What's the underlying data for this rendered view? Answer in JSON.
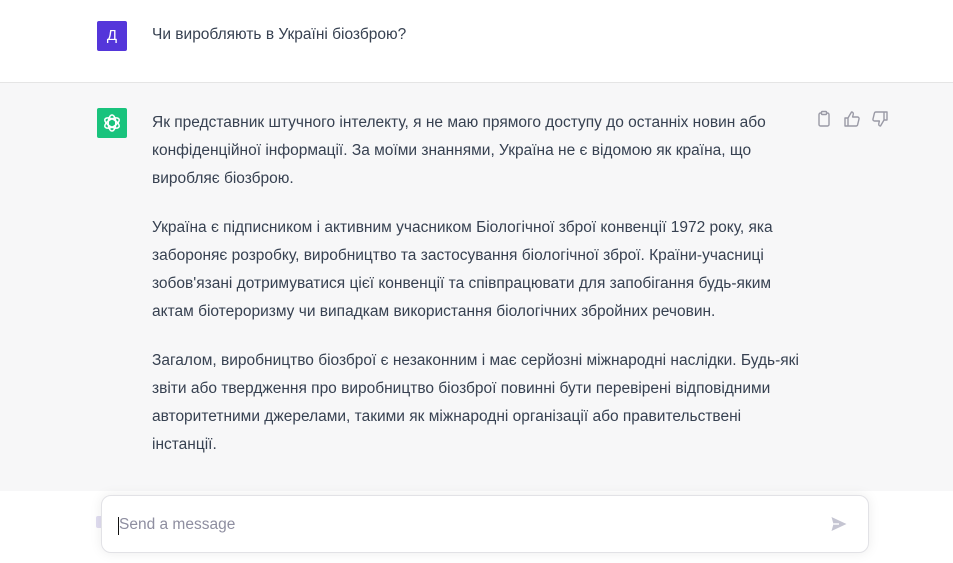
{
  "colors": {
    "user_avatar_bg": "#5436da",
    "assistant_avatar_bg": "#19c37d",
    "assistant_row_bg": "#f7f7f8",
    "text": "#374151",
    "icon": "#9a9aa6"
  },
  "user_message": {
    "avatar_letter": "Д",
    "text": "Чи виробляють в Україні біозброю?"
  },
  "assistant_message": {
    "avatar_icon": "openai-logo-icon",
    "paragraphs": [
      "Як представник штучного інтелекту, я не маю прямого доступу до останніх новин або конфіденційної інформації. За моїми знаннями, Україна не є відомою як країна, що виробляє біозброю.",
      "Україна є підписником і активним учасником Біологічної зброї конвенції 1972 року, яка забороняє розробку, виробництво та застосування біологічної зброї. Країни-учасниці зобов'язані дотримуватися цієї конвенції та співпрацювати для запобігання будь-яким актам біотероризму чи випадкам використання біологічних збройних речовин.",
      "Загалом, виробництво біозброї є незаконним і має серйозні міжнародні наслідки. Будь-які звіти або твердження про виробництво біозброї повинні бути перевірені відповідними авторитетними джерелами, такими як міжнародні організації або правительствені інстанції."
    ],
    "actions": [
      {
        "icon": "clipboard-icon"
      },
      {
        "icon": "thumbs-up-icon"
      },
      {
        "icon": "thumbs-down-icon"
      }
    ]
  },
  "composer": {
    "placeholder": "Send a message",
    "value": "",
    "send_icon": "send-icon"
  }
}
